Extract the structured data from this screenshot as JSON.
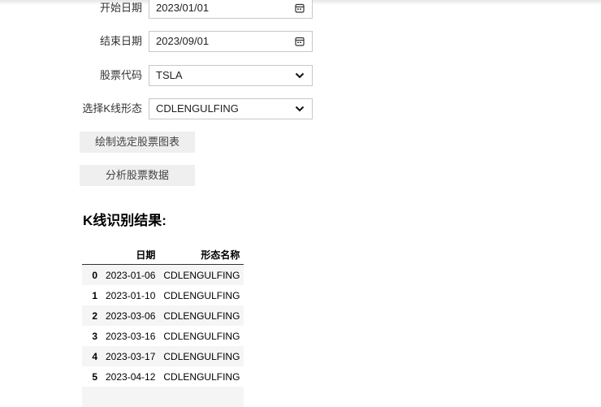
{
  "form": {
    "start_date": {
      "label": "开始日期",
      "value": "2023/01/01"
    },
    "end_date": {
      "label": "结束日期",
      "value": "2023/09/01"
    },
    "stock_code": {
      "label": "股票代码",
      "value": "TSLA"
    },
    "pattern": {
      "label": "选择K线形态",
      "value": "CDLENGULFING"
    }
  },
  "buttons": {
    "plot": "绘制选定股票图表",
    "analyze": "分析股票数据"
  },
  "results": {
    "title": "K线识别结果:",
    "columns": [
      "",
      "日期",
      "形态名称"
    ],
    "rows": [
      [
        "0",
        "2023-01-06",
        "CDLENGULFING"
      ],
      [
        "1",
        "2023-01-10",
        "CDLENGULFING"
      ],
      [
        "2",
        "2023-03-06",
        "CDLENGULFING"
      ],
      [
        "3",
        "2023-03-16",
        "CDLENGULFING"
      ],
      [
        "4",
        "2023-03-17",
        "CDLENGULFING"
      ],
      [
        "5",
        "2023-04-12",
        "CDLENGULFING"
      ]
    ]
  }
}
